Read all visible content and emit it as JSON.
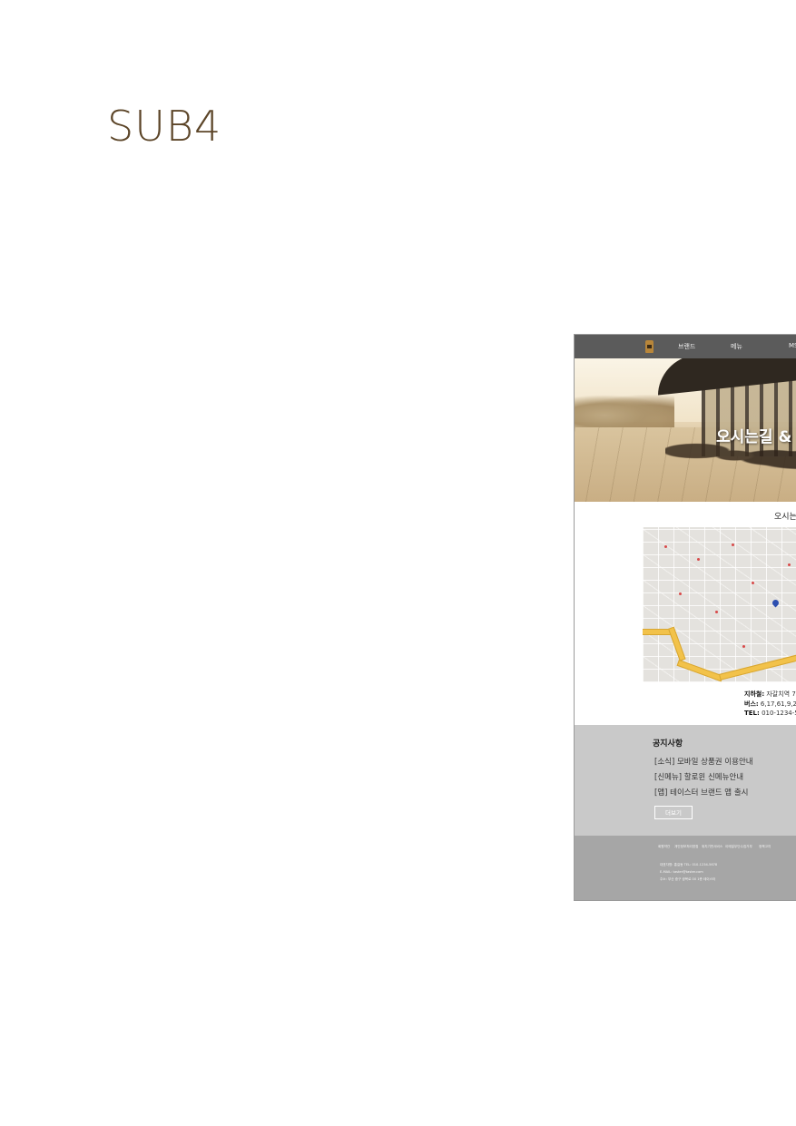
{
  "page": {
    "title": "SUB4"
  },
  "mockup": {
    "nav": {
      "items": [
        "브랜드",
        "메뉴",
        "MS"
      ]
    },
    "hero": {
      "title": "오시는길 &"
    },
    "location": {
      "section_title": "오시는",
      "subway_label": "지하철:",
      "subway_value": "자갈치역 7",
      "bus_label": "버스:",
      "bus_value": "6,17,61,9,26",
      "tel_label": "TEL:",
      "tel_value": "010-1234-56"
    },
    "notice": {
      "title": "공지사항",
      "items": [
        "[소식] 모바일 상품권 이용안내",
        "[신메뉴] 할로윈 신메뉴안내",
        "[앱] 테이스터 브랜드 앱 출시"
      ],
      "more_label": "더보기"
    },
    "footer": {
      "links": [
        "회원약관",
        "개인정보처리방침",
        "위치기반서비스",
        "이메일무단수집거부",
        "정책고지"
      ],
      "info_lines": [
        "대표자명: 홍길동 TEL: 010-1234-5678",
        "E-MAIL: taster@taster.com",
        "주소: 부산 중구 광복로 00 1층 테이스터"
      ]
    }
  },
  "colors": {
    "title": "#5c4528",
    "nav_bg": "#5b5b5b",
    "notice_bg": "#c9c9c9",
    "footer_bg": "#a6a6a6",
    "map_road": "#f2c24a",
    "map_pin": "#2d4fb0"
  }
}
